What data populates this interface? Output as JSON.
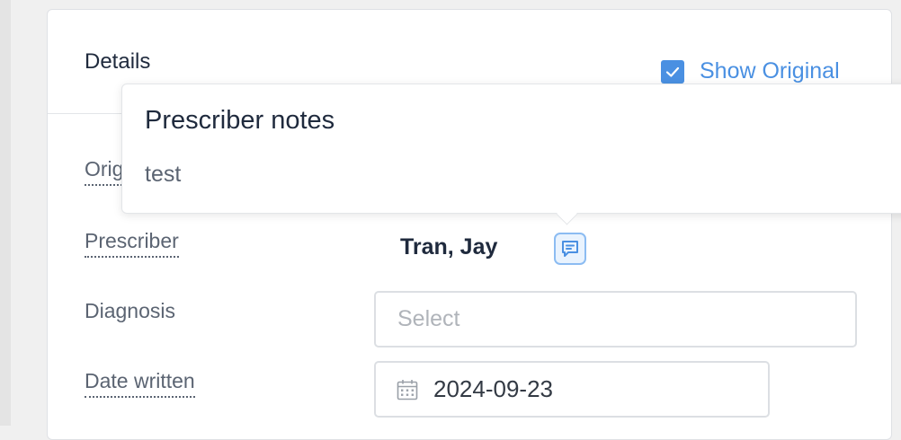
{
  "details": {
    "title": "Details",
    "show_original": {
      "label": "Show Original",
      "checked": true
    }
  },
  "fields": {
    "original_label": "Orig",
    "prescriber": {
      "label": "Prescriber",
      "value": "Tran, Jay"
    },
    "diagnosis": {
      "label": "Diagnosis",
      "placeholder": "Select"
    },
    "date_written": {
      "label": "Date written",
      "value": "2024-09-23"
    }
  },
  "popover": {
    "title": "Prescriber notes",
    "body": "test"
  },
  "icons": {
    "checkbox": "check-icon",
    "notes": "note-icon",
    "date": "calendar-icon"
  },
  "colors": {
    "accent": "#4a90e2",
    "text": "#1f2a3d",
    "muted": "#5b6472",
    "placeholder": "#b0b4ba"
  }
}
